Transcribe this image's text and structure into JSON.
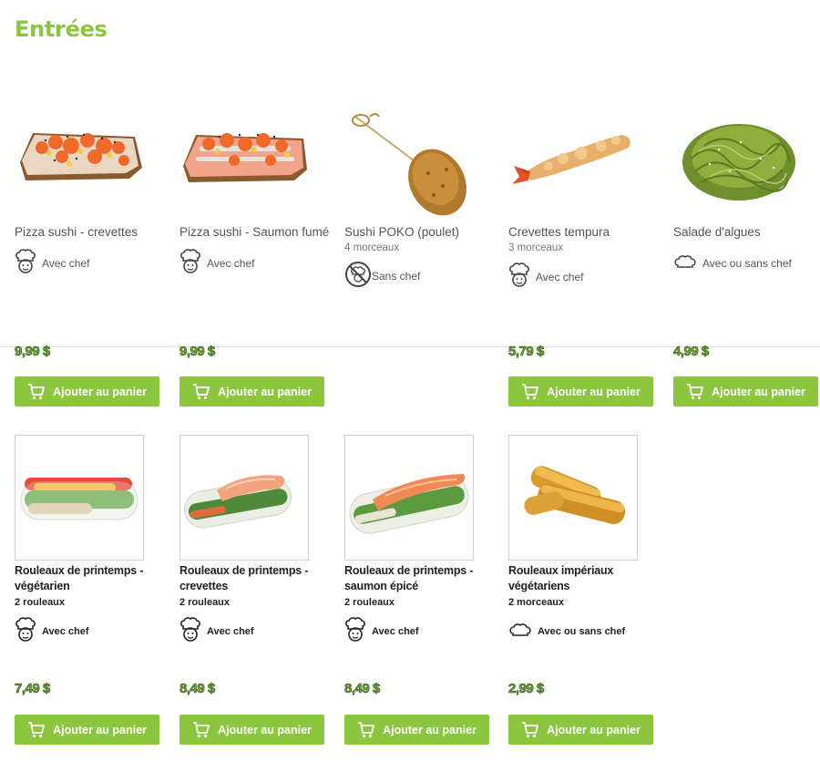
{
  "section": {
    "title": "Entrées"
  },
  "colors": {
    "accent": "#8cc63f",
    "price": "#6aa832"
  },
  "products": [
    {
      "name": "Pizza sushi - crevettes",
      "pieces": "",
      "chef": "Avec chef",
      "chef_icon": "chef-hat-icon",
      "price": "9,99 $",
      "cta": "Ajouter au panier"
    },
    {
      "name": "Pizza sushi - Saumon fumé",
      "pieces": "",
      "chef": "Avec chef",
      "chef_icon": "chef-hat-icon",
      "price": "9,99 $",
      "cta": "Ajouter au panier"
    },
    {
      "name": "Sushi POKO (poulet)",
      "pieces": "4 morceaux",
      "chef": "Sans chef",
      "chef_icon": "no-chef-icon",
      "price": "",
      "cta": ""
    },
    {
      "name": "Crevettes tempura",
      "pieces": "3 morceaux",
      "chef": "Avec chef",
      "chef_icon": "chef-hat-icon",
      "price": "5,79 $",
      "cta": "Ajouter au panier"
    },
    {
      "name": "Salade d'algues",
      "pieces": "",
      "chef": "Avec ou sans chef",
      "chef_icon": "chef-toque-outline-icon",
      "price": "4,99 $",
      "cta": "Ajouter au panier"
    },
    {
      "name": "Rouleaux de printemps - végétarien",
      "pieces": "2 rouleaux",
      "chef": "Avec chef",
      "chef_icon": "chef-hat-icon",
      "price": "7,49 $",
      "cta": "Ajouter au panier"
    },
    {
      "name": "Rouleaux de printemps - crevettes",
      "pieces": "2 rouleaux",
      "chef": "Avec chef",
      "chef_icon": "chef-hat-icon",
      "price": "8,49 $",
      "cta": "Ajouter au panier"
    },
    {
      "name": "Rouleaux de printemps - saumon épicé",
      "pieces": "2 rouleaux",
      "chef": "Avec chef",
      "chef_icon": "chef-hat-icon",
      "price": "8,49 $",
      "cta": "Ajouter au panier"
    },
    {
      "name": "Rouleaux impériaux végétariens",
      "pieces": "2 morceaux",
      "chef": "Avec ou sans chef",
      "chef_icon": "chef-toque-outline-icon",
      "price": "2,99 $",
      "cta": "Ajouter au panier"
    }
  ]
}
